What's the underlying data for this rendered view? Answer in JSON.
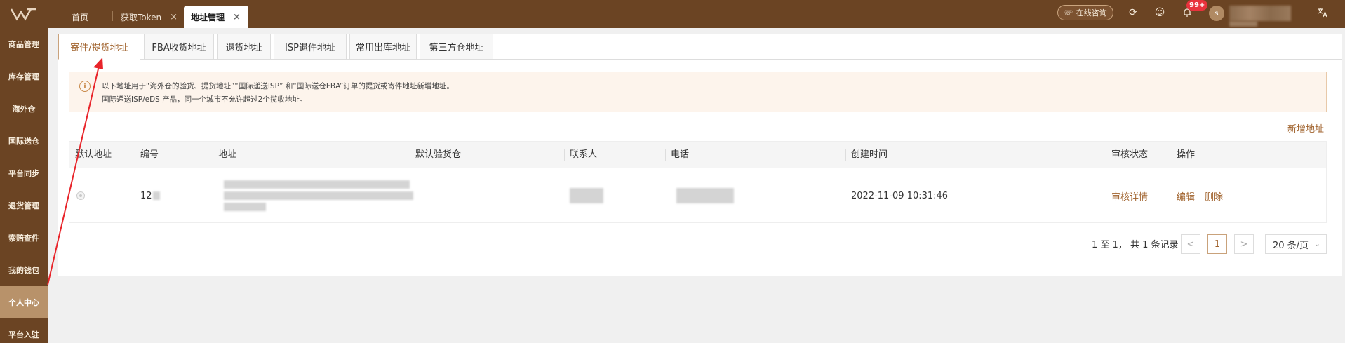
{
  "topbar": {
    "tabs": [
      {
        "label": "首页",
        "closable": false
      },
      {
        "label": "获取Token",
        "closable": true
      },
      {
        "label": "地址管理",
        "closable": true,
        "active": true
      }
    ],
    "close_glyph": "×",
    "consult_label": "在线咨询",
    "notification_badge": "99+",
    "avatar_initial": "s"
  },
  "sidebar": {
    "items": [
      {
        "label": "商品管理"
      },
      {
        "label": "库存管理"
      },
      {
        "label": "海外仓"
      },
      {
        "label": "国际送仓"
      },
      {
        "label": "平台同步"
      },
      {
        "label": "退货管理"
      },
      {
        "label": "索赔查件"
      },
      {
        "label": "我的钱包"
      },
      {
        "label": "个人中心",
        "active": true
      },
      {
        "label": "平台入驻"
      }
    ]
  },
  "address_tabs": [
    {
      "label": "寄件/提货地址",
      "active": true
    },
    {
      "label": "FBA收货地址"
    },
    {
      "label": "退货地址"
    },
    {
      "label": "ISP退件地址"
    },
    {
      "label": "常用出库地址"
    },
    {
      "label": "第三方仓地址"
    }
  ],
  "notice": {
    "icon": "info-icon",
    "lines": [
      "以下地址用于“海外仓的验货、提货地址”“国际递送ISP” 和“国际送仓FBA”订单的提货或寄件地址新增地址。",
      "国际递送ISP/eDS 产品，同一个城市不允许超过2个揽收地址。"
    ]
  },
  "add_address_label": "新增地址",
  "table": {
    "headers": [
      "默认地址",
      "编号",
      "地址",
      "默认验货仓",
      "联系人",
      "电话",
      "创建时间",
      "审核状态",
      "操作"
    ],
    "rows": [
      {
        "id_visible": "12",
        "created_at": "2022-11-09 10:31:46",
        "review_label": "审核详情",
        "edit_label": "编辑",
        "delete_label": "删除"
      }
    ]
  },
  "pagination": {
    "summary": "1 至 1， 共 1 条记录",
    "prev": "<",
    "current_page": "1",
    "next": ">",
    "page_size": "20 条/页"
  },
  "colors": {
    "brand": "#6b4423",
    "accent": "#a0622c",
    "annotation_arrow": "#e8242a"
  }
}
